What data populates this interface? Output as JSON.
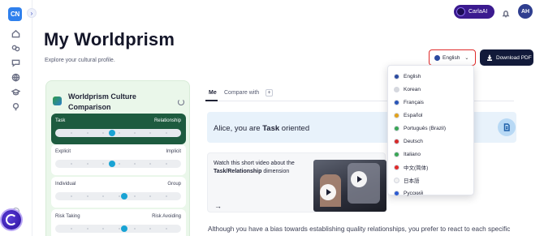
{
  "brand": {
    "logo_text": "CN"
  },
  "rail": {
    "icons": [
      "home-icon",
      "globe-people-icon",
      "chat-icon",
      "globe-icon",
      "graduation-cap-icon",
      "lightbulb-icon"
    ]
  },
  "topbar": {
    "assistant_label": "CarlaAI",
    "avatar_initials": "AH"
  },
  "header": {
    "title": "My Worldprism",
    "subtitle": "Explore your cultural profile.",
    "language_button": "English",
    "pdf_button": "Download PDF"
  },
  "language_menu": {
    "options": [
      {
        "label": "English",
        "flag": "#2a4aa0"
      },
      {
        "label": "Korean",
        "flag": "#d6d8de"
      },
      {
        "label": "Français",
        "flag": "#2855b8"
      },
      {
        "label": "Español",
        "flag": "#e3a21a"
      },
      {
        "label": "Português (Brazil)",
        "flag": "#3aa655"
      },
      {
        "label": "Deutsch",
        "flag": "#d62a2a"
      },
      {
        "label": "Italiano",
        "flag": "#3aa655"
      },
      {
        "label": "中文(简体)",
        "flag": "#e12a2a"
      },
      {
        "label": "日本語",
        "flag": "#f2f2f2"
      },
      {
        "label": "Русский",
        "flag": "#2d5bd2"
      }
    ]
  },
  "culture_card": {
    "title": "Worldprism Culture Comparison",
    "dimensions": [
      {
        "left": "Task",
        "right": "Relationship",
        "value": 0.45,
        "active": true
      },
      {
        "left": "Explicit",
        "right": "Implicit",
        "value": 0.45,
        "active": false
      },
      {
        "left": "Individual",
        "right": "Group",
        "value": 0.55,
        "active": false
      },
      {
        "left": "Risk Taking",
        "right": "Risk Avoiding",
        "value": 0.55,
        "active": false
      }
    ]
  },
  "tabs": {
    "me": "Me",
    "compare": "Compare with",
    "add": "+"
  },
  "banner": {
    "prefix": "Alice, you are ",
    "emphasis": "Task",
    "suffix": " oriented"
  },
  "video": {
    "line1": "Watch this short video about the",
    "line2_bold": "Task/Relationship",
    "line2_rest": " dimension",
    "arrow": "→"
  },
  "paragraph": "Although you have a bias towards establishing quality relationships, you prefer to react to each specific"
}
